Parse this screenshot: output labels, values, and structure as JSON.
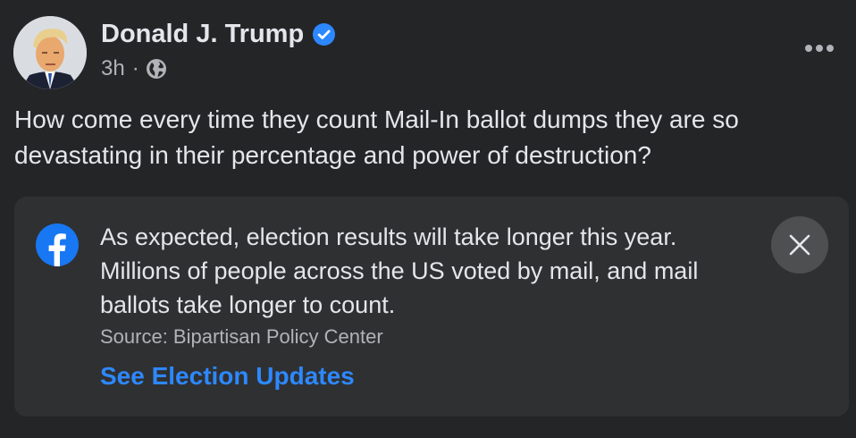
{
  "post": {
    "author_name": "Donald J. Trump",
    "verified": true,
    "timestamp": "3h",
    "separator": "·",
    "audience_icon": "globe-icon",
    "more_icon": "more-options-icon",
    "text": "How come every time they count Mail-In ballot dumps they are so devastating in their percentage and power of destruction?"
  },
  "info_label": {
    "logo_icon": "facebook-logo-icon",
    "message": "As expected, election results will take longer this year. Millions of people across the US voted by mail, and mail ballots take longer to count.",
    "source": "Source: Bipartisan Policy Center",
    "link_label": "See Election Updates",
    "close_icon": "close-icon"
  },
  "colors": {
    "background": "#242526",
    "panel": "#2f3031",
    "primary_text": "#e4e6eb",
    "secondary_text": "#b0b3b8",
    "link": "#2d88ff",
    "verified_badge": "#2d88ff",
    "facebook_blue": "#1877f2"
  }
}
